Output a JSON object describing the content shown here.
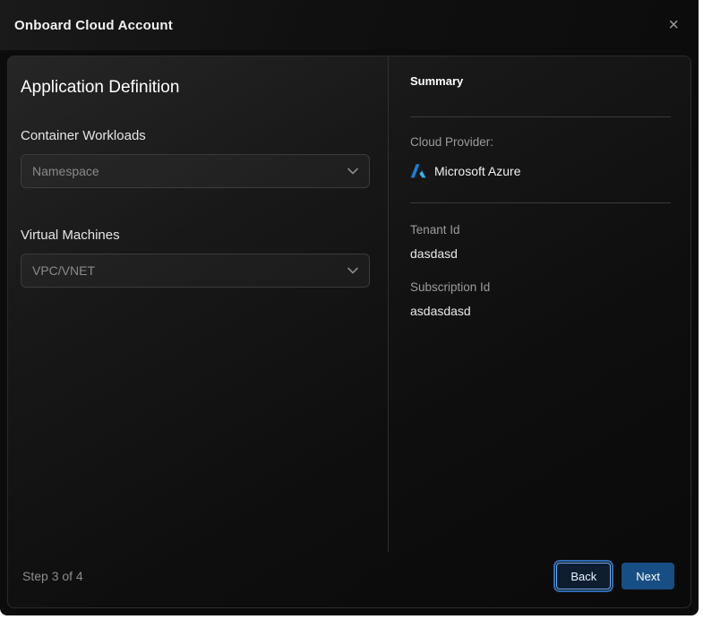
{
  "modal": {
    "title": "Onboard Cloud Account",
    "close_icon": "×"
  },
  "application": {
    "title": "Application Definition",
    "container_workloads": {
      "label": "Container Workloads",
      "placeholder": "Namespace"
    },
    "virtual_machines": {
      "label": "Virtual Machines",
      "placeholder": "VPC/VNET"
    }
  },
  "summary": {
    "title": "Summary",
    "cloud_provider": {
      "label": "Cloud Provider:",
      "value": "Microsoft Azure",
      "icon": "azure-icon"
    },
    "fields": [
      {
        "label": "Tenant Id",
        "value": "dasdasd"
      },
      {
        "label": "Subscription Id",
        "value": "asdasdasd"
      }
    ]
  },
  "footer": {
    "step_indicator": "Step 3 of 4",
    "back_label": "Back",
    "next_label": "Next"
  },
  "colors": {
    "accent_blue": "#7ab5f2",
    "focus_ring_blue": "#2e6cb5",
    "next_button_bg": "#174e84",
    "azure_blue_dark": "#1b7fd4",
    "azure_blue_light": "#35b4ee"
  }
}
